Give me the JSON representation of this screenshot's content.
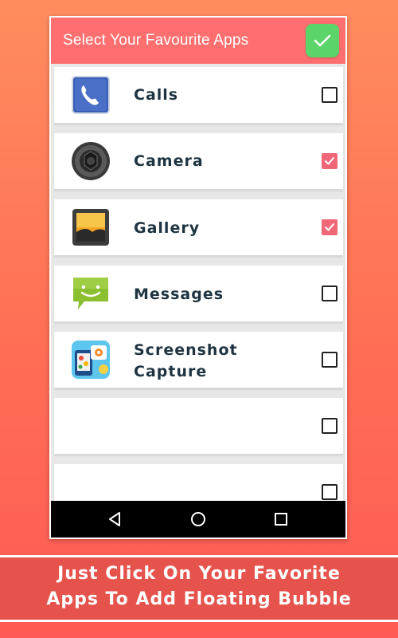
{
  "header": {
    "title": "Select Your Favourite Apps"
  },
  "apps": [
    {
      "name": "Calls",
      "icon": "phone-icon",
      "checked": false
    },
    {
      "name": "Camera",
      "icon": "camera-icon",
      "checked": true
    },
    {
      "name": "Gallery",
      "icon": "gallery-icon",
      "checked": true
    },
    {
      "name": "Messages",
      "icon": "messages-icon",
      "checked": false
    },
    {
      "name": "Screenshot Capture",
      "name_line1": "Screenshot",
      "name_line2": "Capture",
      "icon": "screenshot-capture-icon",
      "checked": false
    },
    {
      "name": "",
      "checked": false
    },
    {
      "name": "",
      "checked": false
    }
  ],
  "navbar": {
    "icons": [
      "back-icon",
      "home-icon",
      "recents-icon"
    ]
  },
  "banner": {
    "line1": "Just Click On Your Favorite",
    "line2": "Apps To Add Floating Bubble"
  },
  "colors": {
    "header": "#ff6f6f",
    "confirm": "#5bd56a",
    "checked": "#f06878",
    "banner": "#e5534c"
  }
}
